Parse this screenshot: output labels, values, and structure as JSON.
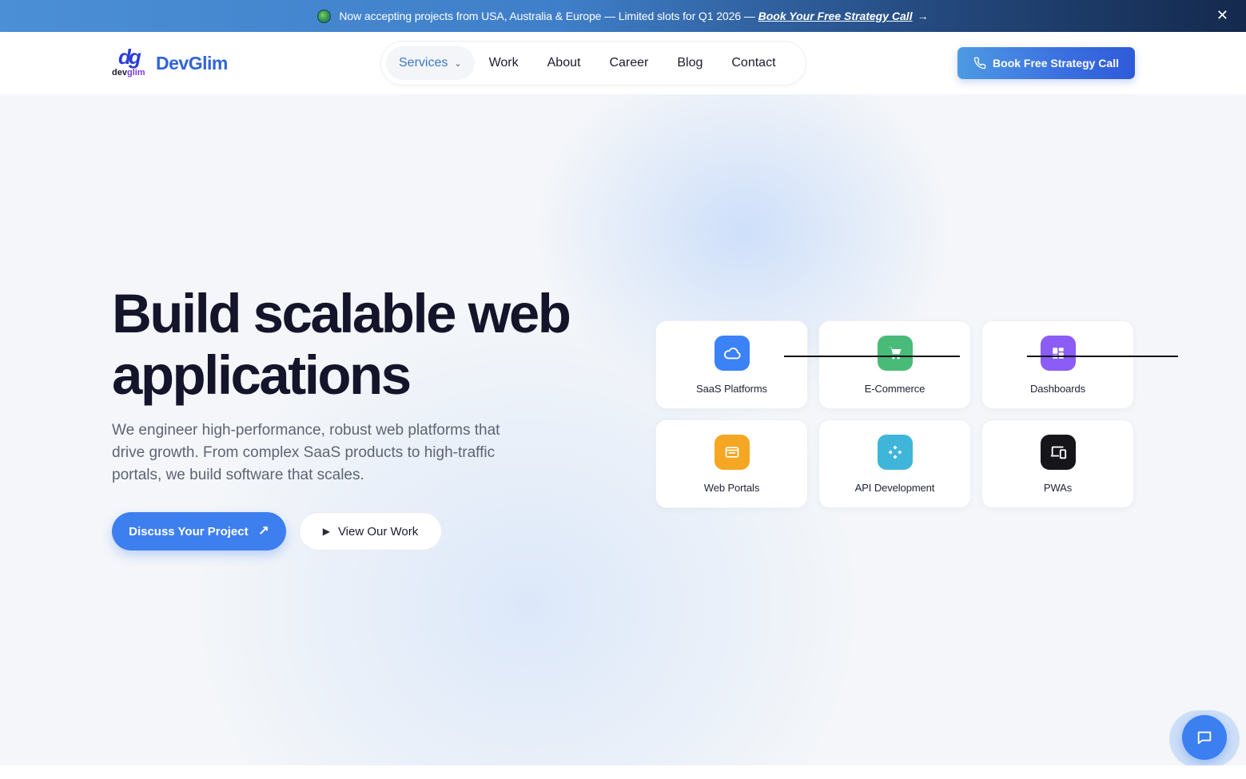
{
  "announcement": {
    "message": "Now accepting projects from USA, Australia & Europe — Limited slots for Q1 2026 —",
    "cta": "Book Your Free Strategy Call",
    "arrow": "→",
    "close": "✕"
  },
  "header": {
    "logo_mark": "dg",
    "logo_sub_prefix": "dev",
    "logo_sub_suffix": "glim",
    "brand_name": "DevGlim",
    "nav": [
      {
        "label": "Services",
        "active": true,
        "has_dropdown": true
      },
      {
        "label": "Work"
      },
      {
        "label": "About"
      },
      {
        "label": "Career"
      },
      {
        "label": "Blog"
      },
      {
        "label": "Contact"
      }
    ],
    "book_call_label": "Book Free Strategy Call"
  },
  "hero": {
    "title_line1": "Build scalable web",
    "title_line2": "applications",
    "description": "We engineer high-performance, robust web platforms that drive growth. From complex SaaS products to high-traffic portals, we build software that scales.",
    "primary_button": "Discuss Your Project",
    "primary_arrow": "↗",
    "secondary_button": "View Our Work",
    "secondary_icon": "▶"
  },
  "services": [
    {
      "label": "SaaS Platforms",
      "icon": "cloud-icon",
      "color": "#3b82f6"
    },
    {
      "label": "E-Commerce",
      "icon": "cart-icon",
      "color": "#48bb78"
    },
    {
      "label": "Dashboards",
      "icon": "dashboard-icon",
      "color": "#8b5cf6"
    },
    {
      "label": "Web Portals",
      "icon": "browser-window-icon",
      "color": "#f5a623"
    },
    {
      "label": "API Development",
      "icon": "api-nodes-icon",
      "color": "#3fb6d9"
    },
    {
      "label": "PWAs",
      "icon": "devices-icon",
      "color": "#15151a"
    }
  ],
  "colors": {
    "accent": "#3e7ff0",
    "brand": "#3164d8",
    "title": "#14152b"
  }
}
